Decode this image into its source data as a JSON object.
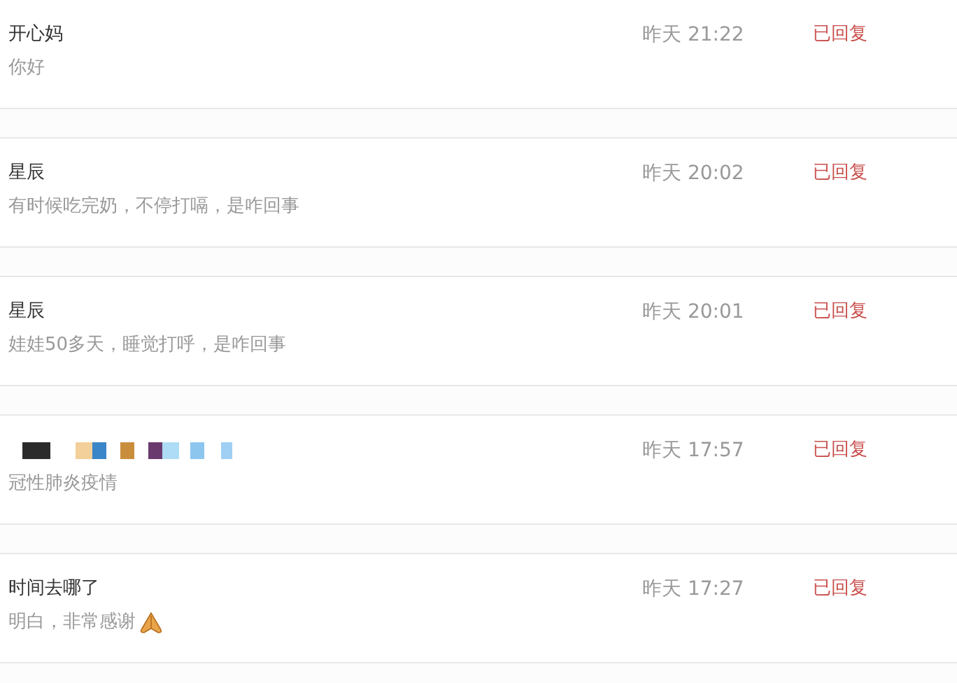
{
  "messages": [
    {
      "kind": "text",
      "name": "开心妈",
      "preview": "你好",
      "time": "昨天 21:22",
      "status": "已回复"
    },
    {
      "kind": "text",
      "name": "星辰",
      "preview": "有时候吃完奶，不停打嗝，是咋回事",
      "time": "昨天 20:02",
      "status": "已回复"
    },
    {
      "kind": "text",
      "name": "星辰",
      "preview": "娃娃50多天，睡觉打呼，是咋回事",
      "time": "昨天 20:01",
      "status": "已回复"
    },
    {
      "kind": "redacted",
      "preview": "冠性肺炎疫情",
      "time": "昨天 17:57",
      "status": "已回复"
    },
    {
      "kind": "text",
      "name": "时间去哪了",
      "preview": "明白，非常感谢",
      "emoji": true,
      "time": "昨天 17:27",
      "status": "已回复"
    }
  ]
}
